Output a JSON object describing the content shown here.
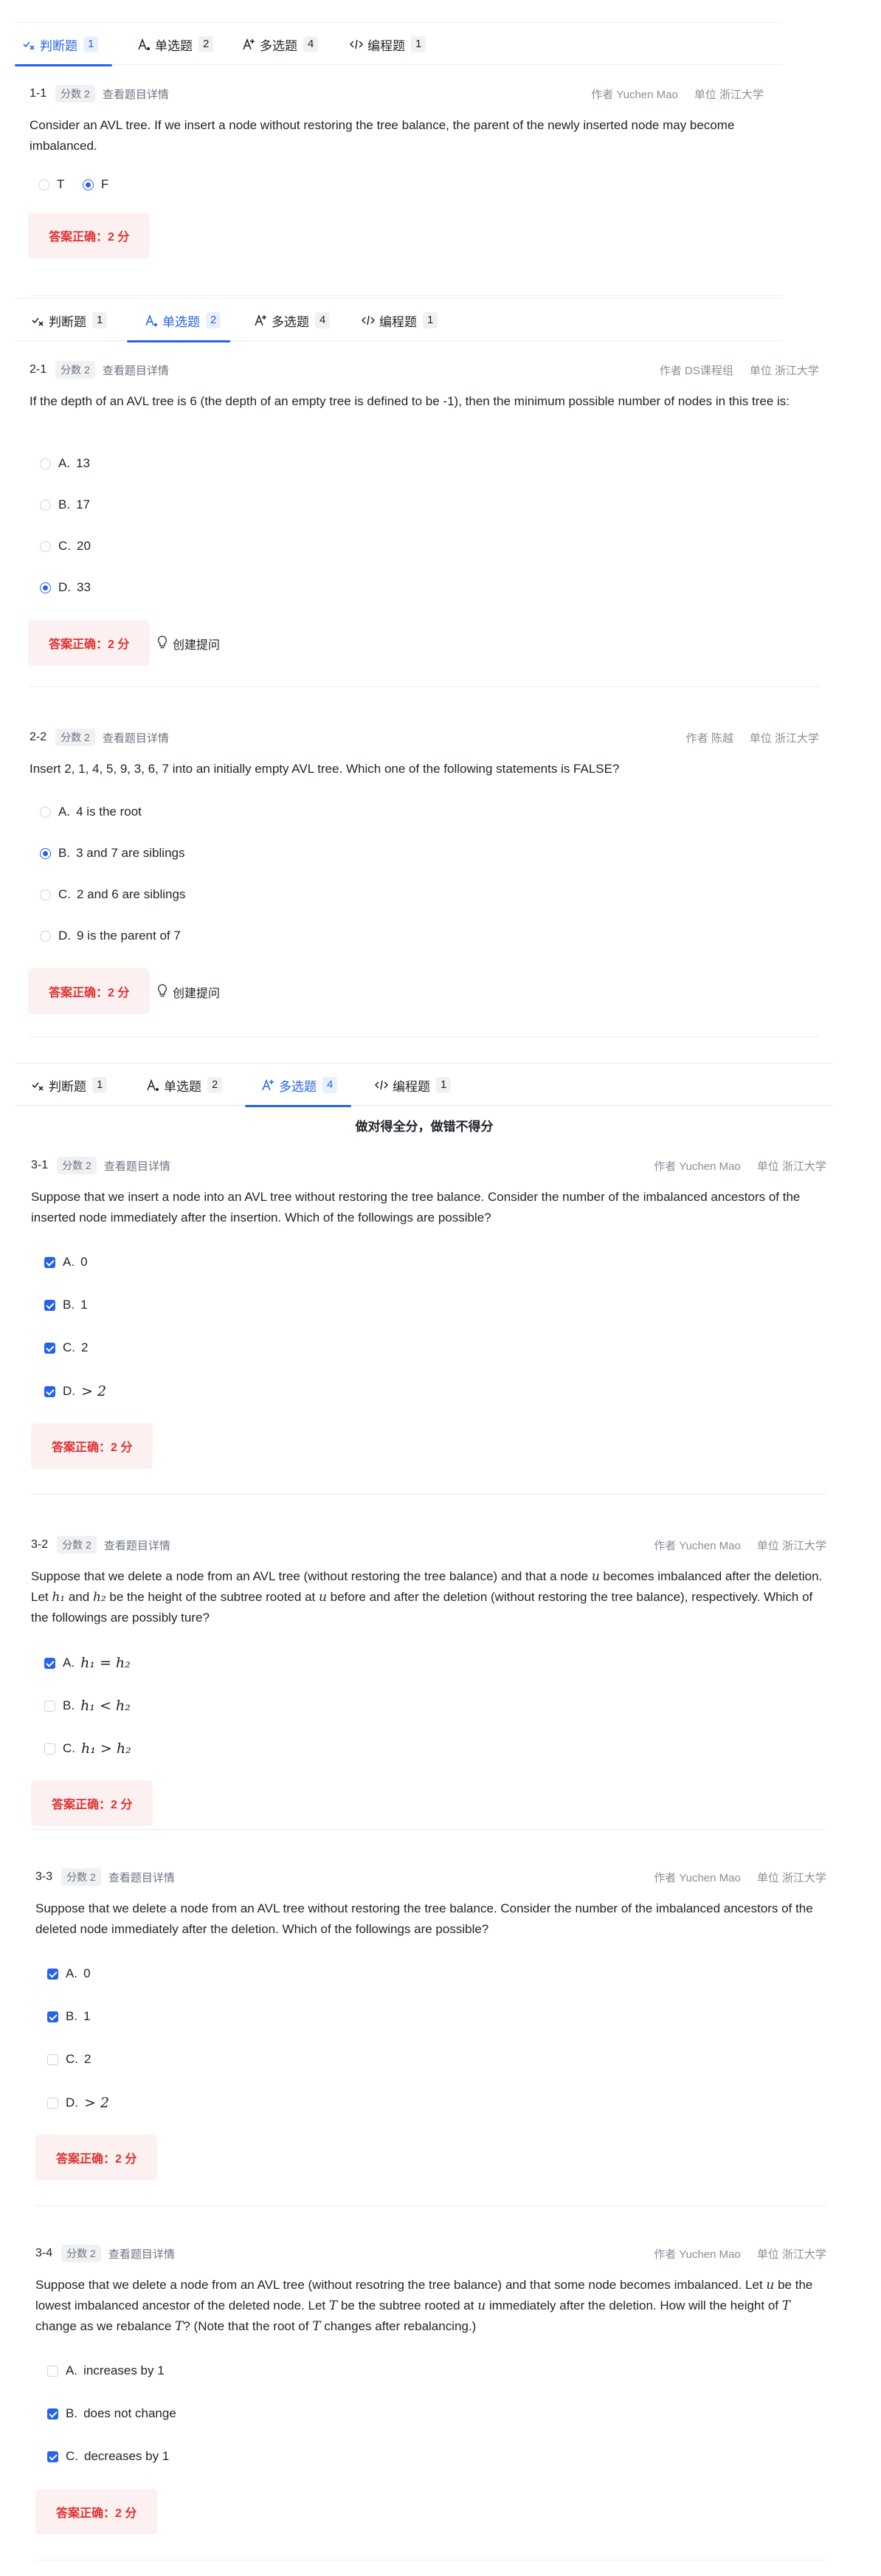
{
  "tab_labels": {
    "tf": "判断题",
    "single": "单选题",
    "multi": "多选题",
    "prog": "编程题"
  },
  "tab_counts": {
    "tf": "1",
    "single": "2",
    "multi": "4",
    "prog": "1"
  },
  "icons": {
    "tf": "true-false-icon",
    "single": "single-choice-icon",
    "multi": "multi-choice-icon",
    "prog": "code-icon",
    "ask": "lightbulb-icon"
  },
  "colors": {
    "accent": "#2563eb",
    "correct_text": "#e03131",
    "correct_bg": "#fdf0f0"
  },
  "common": {
    "score": "分数 2",
    "detail": "查看题目详情",
    "correct": "答案正确：2 分",
    "ask": "创建提问"
  },
  "multi_note": "做对得全分，做错不得分",
  "q1_1": {
    "num": "1-1",
    "author": "作者 Yuchen Mao",
    "unit": "单位 浙江大学",
    "text": "Consider an AVL tree. If we insert a node without restoring the tree balance, the parent of the newly inserted node may become imbalanced.",
    "options": [
      {
        "text": "T",
        "selected": false
      },
      {
        "text": "F",
        "selected": true
      }
    ]
  },
  "q2_1": {
    "num": "2-1",
    "author": "作者 DS课程组",
    "unit": "单位 浙江大学",
    "text": "If the depth of an AVL tree is 6 (the depth of an empty tree is defined to be -1), then the minimum possible number of nodes in this tree is:",
    "options": [
      {
        "label": "A.",
        "text": "13",
        "selected": false
      },
      {
        "label": "B.",
        "text": "17",
        "selected": false
      },
      {
        "label": "C.",
        "text": "20",
        "selected": false
      },
      {
        "label": "D.",
        "text": "33",
        "selected": true
      }
    ]
  },
  "q2_2": {
    "num": "2-2",
    "author": "作者 陈越",
    "unit": "单位 浙江大学",
    "text": "Insert 2, 1, 4, 5, 9, 3, 6, 7 into an initially empty AVL tree. Which one of the following statements is FALSE?",
    "options": [
      {
        "label": "A.",
        "text": "4 is the root",
        "selected": false
      },
      {
        "label": "B.",
        "text": "3 and 7 are siblings",
        "selected": true
      },
      {
        "label": "C.",
        "text": "2 and 6 are siblings",
        "selected": false
      },
      {
        "label": "D.",
        "text": "9 is the parent of 7",
        "selected": false
      }
    ]
  },
  "q3_1": {
    "num": "3-1",
    "author": "作者 Yuchen Mao",
    "unit": "单位 浙江大学",
    "text": "Suppose that we insert a node into an AVL tree without restoring the tree balance. Consider the number of the imbalanced ancestors of the inserted node immediately after the insertion. Which of the followings are possible?",
    "options": [
      {
        "label": "A.",
        "text": "0",
        "checked": true
      },
      {
        "label": "B.",
        "text": "1",
        "checked": true
      },
      {
        "label": "C.",
        "text": "2",
        "checked": true
      },
      {
        "label": "D.",
        "text": "> 2",
        "checked": true
      }
    ]
  },
  "q3_2": {
    "num": "3-2",
    "author": "作者 Yuchen Mao",
    "unit": "单位 浙江大学",
    "text_parts": {
      "a": "Suppose that we delete a node from an AVL tree (without restoring the tree balance) and that a node ",
      "u1": "u",
      "b": " becomes imbalanced after the deletion. Let ",
      "h1": "h₁",
      "c": " and ",
      "h2": "h₂",
      "d": " be the height of the subtree rooted at ",
      "u2": "u",
      "e": " before and after the deletion (without restoring the tree balance), respectively. Which of the followings are possibly ture?"
    },
    "options": [
      {
        "label": "A.",
        "text": "h₁ = h₂",
        "checked": true
      },
      {
        "label": "B.",
        "text": "h₁ < h₂",
        "checked": false
      },
      {
        "label": "C.",
        "text": "h₁ > h₂",
        "checked": false
      }
    ]
  },
  "q3_3": {
    "num": "3-3",
    "author": "作者 Yuchen Mao",
    "unit": "单位 浙江大学",
    "text": "Suppose that we delete a node from an AVL tree without restoring the tree balance. Consider the number of the imbalanced ancestors of the deleted node immediately after the deletion. Which of the followings are possible?",
    "options": [
      {
        "label": "A.",
        "text": "0",
        "checked": true
      },
      {
        "label": "B.",
        "text": "1",
        "checked": true
      },
      {
        "label": "C.",
        "text": "2",
        "checked": false
      },
      {
        "label": "D.",
        "text": "> 2",
        "checked": false
      }
    ]
  },
  "q3_4": {
    "num": "3-4",
    "author": "作者 Yuchen Mao",
    "unit": "单位 浙江大学",
    "text_parts": {
      "a": "Suppose that we delete a node from an AVL tree (without resotring the tree balance) and that some node becomes imbalanced. Let ",
      "u1": "u",
      "b": " be the lowest imbalanced ancestor of the deleted node. Let ",
      "t1": "T",
      "c": " be the subtree rooted at ",
      "u2": "u",
      "d": " immediately after the deletion. How will the height of ",
      "t2": "T",
      "e": " change as we rebalance ",
      "t3": "T",
      "f": "? (Note that the root of ",
      "t4": "T",
      "g": " changes after rebalancing.)"
    },
    "options": [
      {
        "label": "A.",
        "text": "increases by 1",
        "checked": false
      },
      {
        "label": "B.",
        "text": "does not change",
        "checked": true
      },
      {
        "label": "C.",
        "text": "decreases by 1",
        "checked": true
      }
    ]
  }
}
